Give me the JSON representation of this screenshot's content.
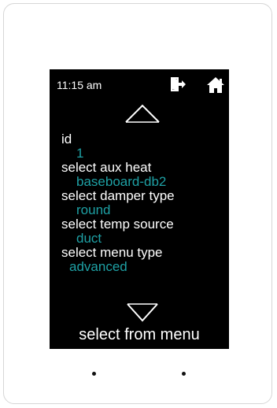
{
  "status_bar": {
    "time": "11:15 am",
    "icons": [
      "exit-door-icon",
      "home-icon"
    ]
  },
  "settings": [
    {
      "label": "id",
      "value": "1",
      "value_indent": 1
    },
    {
      "label": "select aux heat",
      "value": "baseboard-db2",
      "value_indent": 1
    },
    {
      "label": "select damper type",
      "value": "round",
      "value_indent": 1
    },
    {
      "label": "select temp source",
      "value": "duct",
      "value_indent": 1
    },
    {
      "label": "select menu type",
      "value": "advanced",
      "value_indent": 0
    }
  ],
  "footer": {
    "text": "select from menu"
  },
  "colors": {
    "screen_bg": "#000000",
    "label": "#ffffff",
    "value_accent": "#1ea0a4"
  }
}
